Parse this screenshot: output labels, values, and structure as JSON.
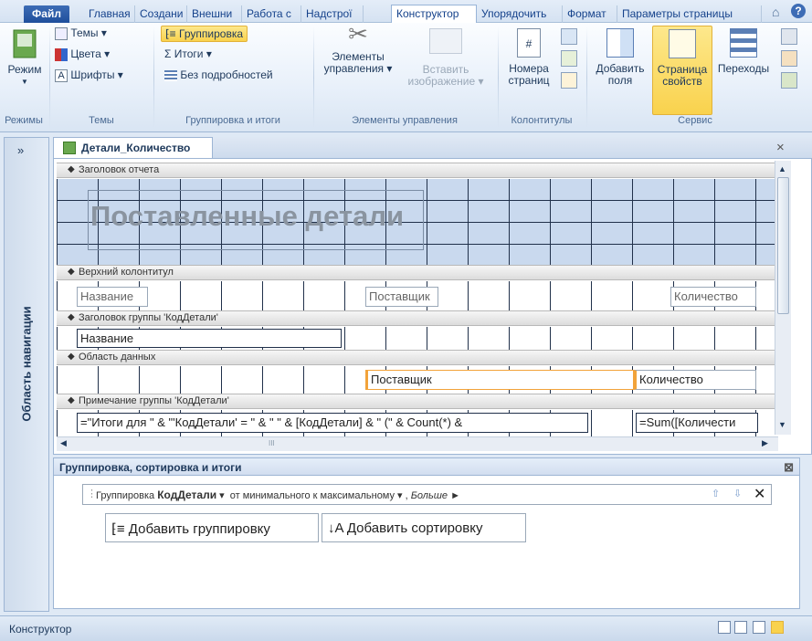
{
  "tabs": [
    "Файл",
    "Главная",
    "Создани",
    "Внешни",
    "Работа с",
    "Надстрої",
    "Конструктор",
    "Упорядочить",
    "Формат",
    "Параметры страницы"
  ],
  "ribbon": {
    "mode_label": "Режим",
    "modes_group": "Режимы",
    "themes_label": "Темы",
    "colors_label": "Цвета",
    "fonts_label": "Шрифты",
    "themes_group": "Темы",
    "grouping_label": "Группировка",
    "totals_label": "Итоги",
    "no_details_label": "Без подробностей",
    "grouping_group": "Группировка и итоги",
    "controls_label1": "Элементы",
    "controls_label2": "управления",
    "insert_image_label1": "Вставить",
    "insert_image_label2": "изображение",
    "controls_group": "Элементы управления",
    "page_numbers_label1": "Номера",
    "page_numbers_label2": "страниц",
    "headers_group": "Колонтитулы",
    "add_fields_label1": "Добавить",
    "add_fields_label2": "поля",
    "property_sheet_label1": "Страница",
    "property_sheet_label2": "свойств",
    "transitions_label": "Переходы",
    "service_group": "Сервис"
  },
  "nav": {
    "title": "Область навигации",
    "toggle": "»"
  },
  "document": {
    "tab_title": "Детали_Количество",
    "close": "×",
    "sections": {
      "report_header": "Заголовок отчета",
      "page_header": "Верхний колонтитул",
      "group_header": "Заголовок группы 'КодДетали'",
      "detail": "Область данных",
      "group_footer": "Примечание группы 'КодДетали'"
    },
    "report_title": "Поставленные детали",
    "page_header_labels": [
      "Название",
      "Поставщик",
      "Количество"
    ],
    "group_header_field": "Название",
    "detail_fields": [
      "Поставщик",
      "Количество"
    ],
    "footer_expr": "=\"Итоги для \" & \"'КодДетали' = \" & \" \" & [КодДетали] & \" (\" & Count(*) &",
    "footer_sum": "=Sum([Количести",
    "scroll_mark": "III"
  },
  "grouping_pane": {
    "title": "Группировка, сортировка и итоги",
    "close": "⊠",
    "group_prefix": "Группировка",
    "group_field": "КодДетали",
    "order": "от минимального к максимальному",
    "more": "Больше ►",
    "add_group": "Добавить группировку",
    "add_sort": "Добавить сортировку"
  },
  "status": {
    "mode": "Конструктор"
  }
}
